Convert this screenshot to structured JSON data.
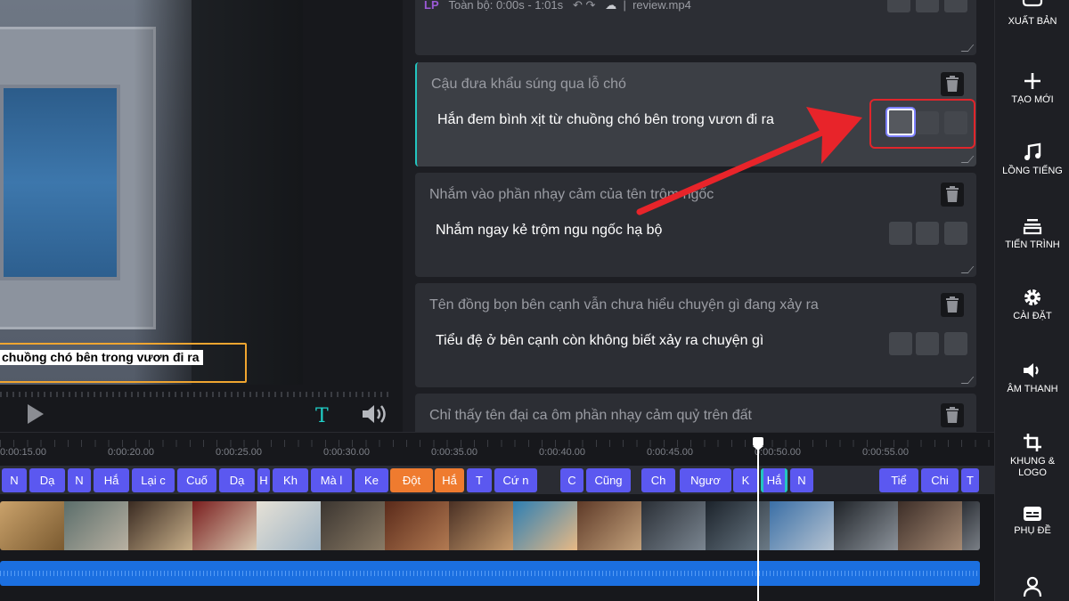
{
  "preview": {
    "subtitle_overlay": "chuồng chó bên trong vươn đi ra",
    "text_tool_glyph": "T"
  },
  "top_card": {
    "breadcrumb_prefix": "LP",
    "breadcrumb_range": "Toàn bộ: 0:00s - 1:01s",
    "file_name": "review.mp4"
  },
  "subtitles": [
    {
      "original": "Cậu đưa khẩu súng qua lỗ chó",
      "translation": "Hắn đem bình xịt từ chuồng chó bên trong vươn đi ra"
    },
    {
      "original": "Nhắm vào phần nhạy cảm của tên trộm ngốc",
      "translation": "Nhắm ngay kẻ trộm ngu ngốc hạ bộ"
    },
    {
      "original": "Tên đồng bọn bên cạnh vẫn chưa hiểu chuyện gì đang xảy ra",
      "translation": "Tiểu đệ ở bên cạnh còn không biết xảy ra chuyện gì"
    },
    {
      "original": "Chỉ thấy tên đại ca ôm phần nhạy cảm quỷ trên đất",
      "translation": ""
    }
  ],
  "sidebar": {
    "publish": "XUẤT BẢN",
    "create_new": "TẠO MỚI",
    "dubbing": "LỒNG TIẾNG",
    "progress": "TIẾN TRÌNH",
    "settings": "CÀI ĐẶT",
    "audio": "ÂM THANH",
    "frame_logo": "KHUNG & LOGO",
    "subtitle": "PHỤ ĐỀ"
  },
  "timeline": {
    "ruler": [
      "0:00:15.00",
      "0:00:20.00",
      "0:00:25.00",
      "0:00:30.00",
      "0:00:35.00",
      "0:00:40.00",
      "0:00:45.00",
      "0:00:50.00",
      "0:00:55.00"
    ],
    "clips": [
      "N",
      "Dạ",
      "N",
      "Hắ",
      "Lại c",
      "Cuố",
      "Dạ",
      "H",
      "Kh",
      "Mà l",
      "Ke",
      "Đột",
      "Hắ",
      "T",
      "Cứ n",
      "C",
      "Cũng",
      "Ch",
      "Ngươ",
      "K",
      "Hắ",
      "N",
      "Tiể",
      "Chi",
      "T"
    ]
  },
  "colors": {
    "accent": "#23c5c0",
    "clip_blue": "#5b58f0",
    "clip_orange": "#ef7b2f",
    "highlight_red": "#e0252b",
    "audio_blue": "#1b6fe0"
  }
}
